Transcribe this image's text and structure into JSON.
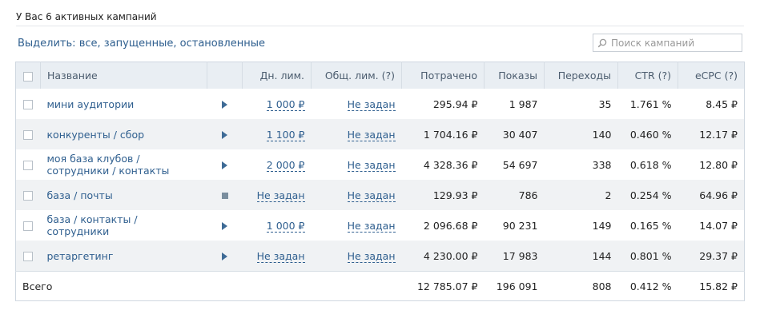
{
  "header": {
    "title": "У Вас 6 активных кампаний"
  },
  "filter": {
    "label": "Выделить:",
    "all": "все",
    "running": "запущенные",
    "stopped": "остановленные",
    "sep": ","
  },
  "search": {
    "placeholder": "Поиск кампаний",
    "icon": "search-icon"
  },
  "table": {
    "columns": {
      "name": "Название",
      "daily_limit": "Дн. лим.",
      "total_limit": "Общ. лим. (?)",
      "spent": "Потрачено",
      "impressions": "Показы",
      "clicks": "Переходы",
      "ctr": "CTR (?)",
      "ecpc": "eCPC (?)"
    },
    "rows": [
      {
        "name": "мини аудитории",
        "status": "play",
        "daily_limit": "1 000 ₽",
        "total_limit": "Не задан",
        "spent": "295.94 ₽",
        "impressions": "1 987",
        "clicks": "35",
        "ctr": "1.761 %",
        "ecpc": "8.45 ₽"
      },
      {
        "name": "конкуренты / сбор",
        "status": "play",
        "daily_limit": "1 100 ₽",
        "total_limit": "Не задан",
        "spent": "1 704.16 ₽",
        "impressions": "30 407",
        "clicks": "140",
        "ctr": "0.460 %",
        "ecpc": "12.17 ₽"
      },
      {
        "name": "моя база клубов / сотрудники / контакты",
        "status": "play",
        "daily_limit": "2 000 ₽",
        "total_limit": "Не задан",
        "spent": "4 328.36 ₽",
        "impressions": "54 697",
        "clicks": "338",
        "ctr": "0.618 %",
        "ecpc": "12.80 ₽"
      },
      {
        "name": "база / почты",
        "status": "stop",
        "daily_limit": "Не задан",
        "total_limit": "Не задан",
        "spent": "129.93 ₽",
        "impressions": "786",
        "clicks": "2",
        "ctr": "0.254 %",
        "ecpc": "64.96 ₽"
      },
      {
        "name": "база / контакты / сотрудники",
        "status": "play",
        "daily_limit": "1 000 ₽",
        "total_limit": "Не задан",
        "spent": "2 096.68 ₽",
        "impressions": "90 231",
        "clicks": "149",
        "ctr": "0.165 %",
        "ecpc": "14.07 ₽"
      },
      {
        "name": "ретаргетинг",
        "status": "play",
        "daily_limit": "Не задан",
        "total_limit": "Не задан",
        "spent": "4 230.00 ₽",
        "impressions": "17 983",
        "clicks": "144",
        "ctr": "0.801 %",
        "ecpc": "29.37 ₽"
      }
    ],
    "total": {
      "label": "Всего",
      "spent": "12 785.07 ₽",
      "impressions": "196 091",
      "clicks": "808",
      "ctr": "0.412 %",
      "ecpc": "15.82 ₽"
    }
  },
  "colors": {
    "link": "#2f5f8f",
    "header_bg": "#e9eef3",
    "stripe_bg": "#f0f2f4",
    "play_icon": "#3e6b96",
    "stop_icon": "#7a8e9e"
  }
}
